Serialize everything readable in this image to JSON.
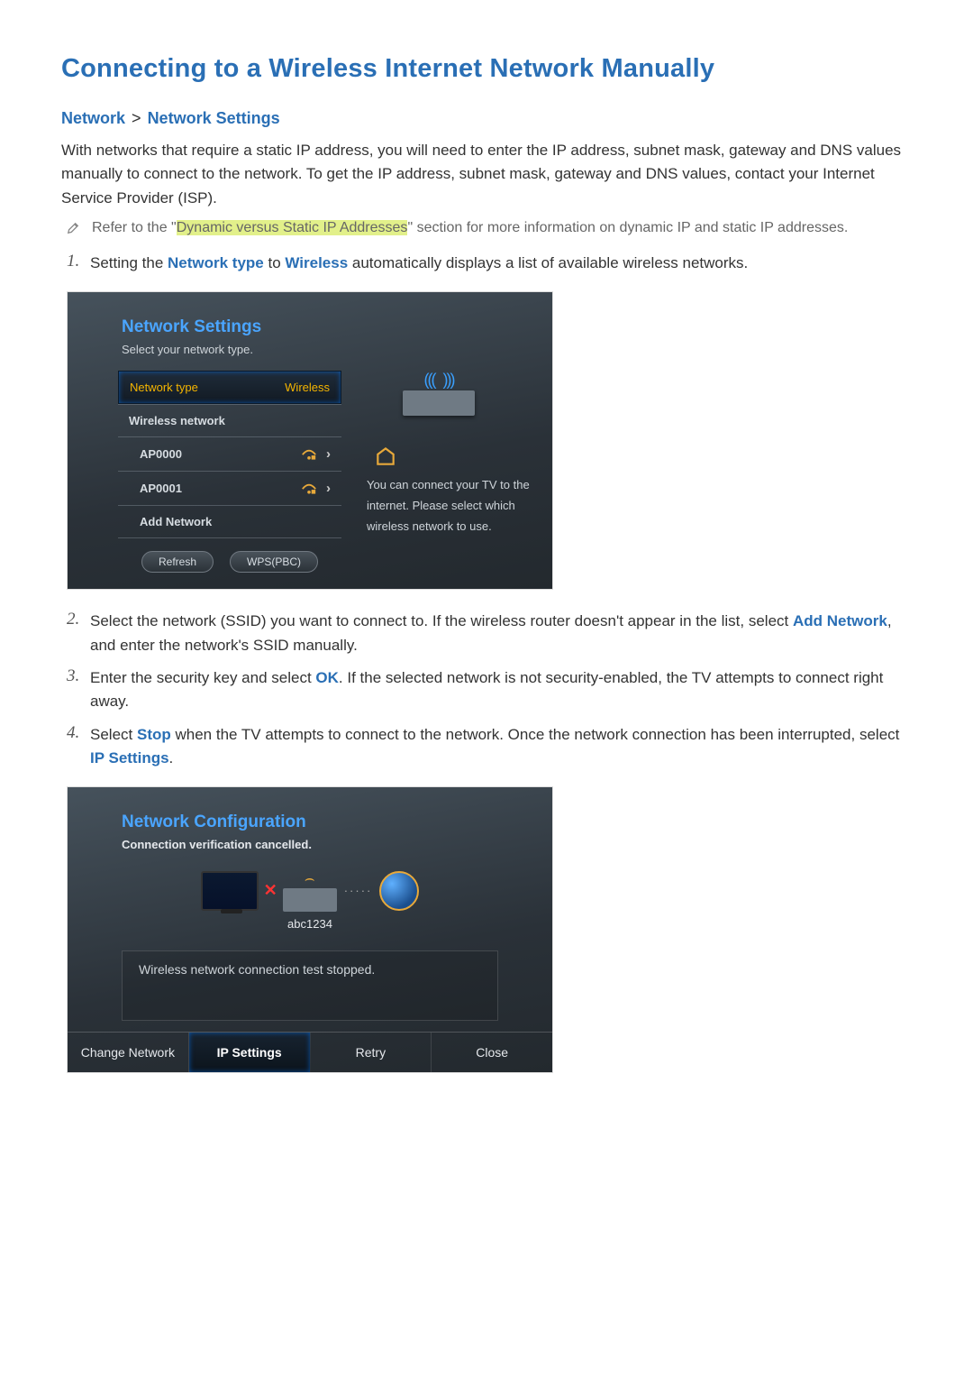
{
  "page": {
    "title": "Connecting to a Wireless Internet Network Manually",
    "breadcrumb": {
      "a": "Network",
      "sep": ">",
      "b": "Network Settings"
    },
    "intro": "With networks that require a static IP address, you will need to enter the IP address, subnet mask, gateway and DNS values manually to connect to the network. To get the IP address, subnet mask, gateway and DNS values, contact your Internet Service Provider (ISP).",
    "note_pre": "Refer to the \"",
    "note_hl": "Dynamic versus Static IP Addresses",
    "note_post": "\" section for more information on dynamic IP and static IP addresses."
  },
  "steps": {
    "s1_pre": "Setting the ",
    "s1_kw1": "Network type",
    "s1_mid": " to ",
    "s1_kw2": "Wireless",
    "s1_post": " automatically displays a list of available wireless networks.",
    "s2_pre": "Select the network (SSID) you want to connect to. If the wireless router doesn't appear in the list, select ",
    "s2_kw1": "Add Network",
    "s2_post": ", and enter the network's SSID manually.",
    "s3_pre": "Enter the security key and select ",
    "s3_kw1": "OK",
    "s3_post": ". If the selected network is not security-enabled, the TV attempts to connect right away.",
    "s4_pre": "Select ",
    "s4_kw1": "Stop",
    "s4_mid": " when the TV attempts to connect to the network. Once the network connection has been interrupted, select ",
    "s4_kw2": "IP Settings",
    "s4_post": "."
  },
  "panel1": {
    "title": "Network Settings",
    "subtitle": "Select your network type.",
    "network_type_label": "Network type",
    "network_type_value": "Wireless",
    "wireless_network_label": "Wireless network",
    "items": {
      "0": "AP0000",
      "1": "AP0001",
      "2": "Add Network"
    },
    "btn_refresh": "Refresh",
    "btn_wps": "WPS(PBC)",
    "side_text": "You can connect your TV to the internet. Please select which wireless network to use."
  },
  "panel2": {
    "title": "Network Configuration",
    "subtitle": "Connection verification cancelled.",
    "ssid": "abc1234",
    "status": "Wireless network connection test stopped.",
    "btn_change": "Change Network",
    "btn_ip": "IP Settings",
    "btn_retry": "Retry",
    "btn_close": "Close"
  },
  "nums": {
    "n1": "1.",
    "n2": "2.",
    "n3": "3.",
    "n4": "4."
  }
}
